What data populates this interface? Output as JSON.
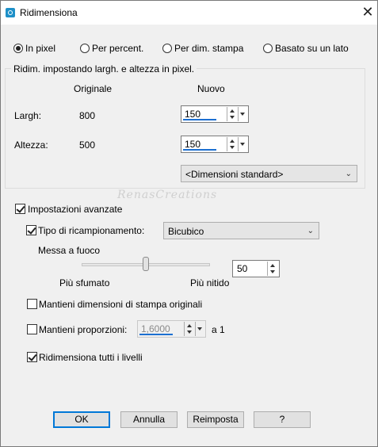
{
  "window": {
    "title": "Ridimensiona",
    "close_label": "✕"
  },
  "mode": {
    "options": [
      {
        "label": "In pixel",
        "selected": true
      },
      {
        "label": "Per percent.",
        "selected": false
      },
      {
        "label": "Per dim. stampa",
        "selected": false
      },
      {
        "label": "Basato su un lato",
        "selected": false
      }
    ]
  },
  "pixel_group": {
    "title": "Ridim. impostando largh. e altezza in pixel.",
    "col_original": "Originale",
    "col_new": "Nuovo",
    "width_label": "Largh:",
    "width_original": "800",
    "width_new": "150",
    "height_label": "Altezza:",
    "height_original": "500",
    "height_new": "150",
    "standard_sizes": "<Dimensioni standard>"
  },
  "watermark": "RenasCreations",
  "advanced": {
    "label": "Impostazioni avanzate",
    "checked": true,
    "resample_label": "Tipo di ricampionamento:",
    "resample_checked": true,
    "resample_value": "Bicubico",
    "sharpen_label": "Messa a fuoco",
    "sharpen_min_label": "Più sfumato",
    "sharpen_max_label": "Più nitido",
    "sharpen_value": "50",
    "sharpen_level": 0.5,
    "keep_print_label": "Mantieni dimensioni di stampa originali",
    "keep_print_checked": false,
    "keep_ratio_label": "Mantieni proporzioni:",
    "keep_ratio_checked": false,
    "ratio_value": "1,6000",
    "ratio_suffix": "a 1",
    "resize_all_label": "Ridimensiona tutti i livelli",
    "resize_all_checked": true
  },
  "buttons": {
    "ok": "OK",
    "cancel": "Annulla",
    "reset": "Reimposta",
    "help": "?"
  },
  "colors": {
    "accent": "#0078d7",
    "underline": "#1c6fd1"
  }
}
